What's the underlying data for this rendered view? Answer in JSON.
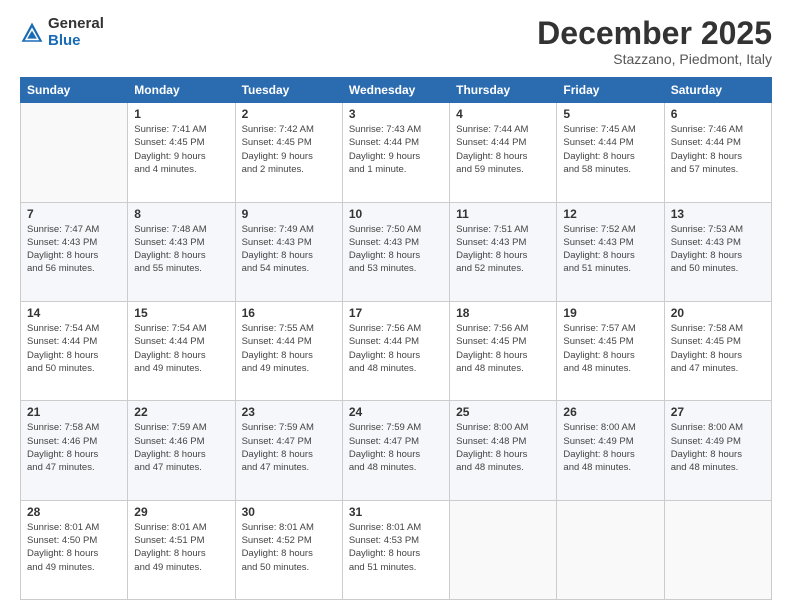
{
  "logo": {
    "general": "General",
    "blue": "Blue"
  },
  "header": {
    "month": "December 2025",
    "location": "Stazzano, Piedmont, Italy"
  },
  "days_of_week": [
    "Sunday",
    "Monday",
    "Tuesday",
    "Wednesday",
    "Thursday",
    "Friday",
    "Saturday"
  ],
  "weeks": [
    [
      {
        "day": "",
        "info": ""
      },
      {
        "day": "1",
        "info": "Sunrise: 7:41 AM\nSunset: 4:45 PM\nDaylight: 9 hours\nand 4 minutes."
      },
      {
        "day": "2",
        "info": "Sunrise: 7:42 AM\nSunset: 4:45 PM\nDaylight: 9 hours\nand 2 minutes."
      },
      {
        "day": "3",
        "info": "Sunrise: 7:43 AM\nSunset: 4:44 PM\nDaylight: 9 hours\nand 1 minute."
      },
      {
        "day": "4",
        "info": "Sunrise: 7:44 AM\nSunset: 4:44 PM\nDaylight: 8 hours\nand 59 minutes."
      },
      {
        "day": "5",
        "info": "Sunrise: 7:45 AM\nSunset: 4:44 PM\nDaylight: 8 hours\nand 58 minutes."
      },
      {
        "day": "6",
        "info": "Sunrise: 7:46 AM\nSunset: 4:44 PM\nDaylight: 8 hours\nand 57 minutes."
      }
    ],
    [
      {
        "day": "7",
        "info": "Sunrise: 7:47 AM\nSunset: 4:43 PM\nDaylight: 8 hours\nand 56 minutes."
      },
      {
        "day": "8",
        "info": "Sunrise: 7:48 AM\nSunset: 4:43 PM\nDaylight: 8 hours\nand 55 minutes."
      },
      {
        "day": "9",
        "info": "Sunrise: 7:49 AM\nSunset: 4:43 PM\nDaylight: 8 hours\nand 54 minutes."
      },
      {
        "day": "10",
        "info": "Sunrise: 7:50 AM\nSunset: 4:43 PM\nDaylight: 8 hours\nand 53 minutes."
      },
      {
        "day": "11",
        "info": "Sunrise: 7:51 AM\nSunset: 4:43 PM\nDaylight: 8 hours\nand 52 minutes."
      },
      {
        "day": "12",
        "info": "Sunrise: 7:52 AM\nSunset: 4:43 PM\nDaylight: 8 hours\nand 51 minutes."
      },
      {
        "day": "13",
        "info": "Sunrise: 7:53 AM\nSunset: 4:43 PM\nDaylight: 8 hours\nand 50 minutes."
      }
    ],
    [
      {
        "day": "14",
        "info": "Sunrise: 7:54 AM\nSunset: 4:44 PM\nDaylight: 8 hours\nand 50 minutes."
      },
      {
        "day": "15",
        "info": "Sunrise: 7:54 AM\nSunset: 4:44 PM\nDaylight: 8 hours\nand 49 minutes."
      },
      {
        "day": "16",
        "info": "Sunrise: 7:55 AM\nSunset: 4:44 PM\nDaylight: 8 hours\nand 49 minutes."
      },
      {
        "day": "17",
        "info": "Sunrise: 7:56 AM\nSunset: 4:44 PM\nDaylight: 8 hours\nand 48 minutes."
      },
      {
        "day": "18",
        "info": "Sunrise: 7:56 AM\nSunset: 4:45 PM\nDaylight: 8 hours\nand 48 minutes."
      },
      {
        "day": "19",
        "info": "Sunrise: 7:57 AM\nSunset: 4:45 PM\nDaylight: 8 hours\nand 48 minutes."
      },
      {
        "day": "20",
        "info": "Sunrise: 7:58 AM\nSunset: 4:45 PM\nDaylight: 8 hours\nand 47 minutes."
      }
    ],
    [
      {
        "day": "21",
        "info": "Sunrise: 7:58 AM\nSunset: 4:46 PM\nDaylight: 8 hours\nand 47 minutes."
      },
      {
        "day": "22",
        "info": "Sunrise: 7:59 AM\nSunset: 4:46 PM\nDaylight: 8 hours\nand 47 minutes."
      },
      {
        "day": "23",
        "info": "Sunrise: 7:59 AM\nSunset: 4:47 PM\nDaylight: 8 hours\nand 47 minutes."
      },
      {
        "day": "24",
        "info": "Sunrise: 7:59 AM\nSunset: 4:47 PM\nDaylight: 8 hours\nand 48 minutes."
      },
      {
        "day": "25",
        "info": "Sunrise: 8:00 AM\nSunset: 4:48 PM\nDaylight: 8 hours\nand 48 minutes."
      },
      {
        "day": "26",
        "info": "Sunrise: 8:00 AM\nSunset: 4:49 PM\nDaylight: 8 hours\nand 48 minutes."
      },
      {
        "day": "27",
        "info": "Sunrise: 8:00 AM\nSunset: 4:49 PM\nDaylight: 8 hours\nand 48 minutes."
      }
    ],
    [
      {
        "day": "28",
        "info": "Sunrise: 8:01 AM\nSunset: 4:50 PM\nDaylight: 8 hours\nand 49 minutes."
      },
      {
        "day": "29",
        "info": "Sunrise: 8:01 AM\nSunset: 4:51 PM\nDaylight: 8 hours\nand 49 minutes."
      },
      {
        "day": "30",
        "info": "Sunrise: 8:01 AM\nSunset: 4:52 PM\nDaylight: 8 hours\nand 50 minutes."
      },
      {
        "day": "31",
        "info": "Sunrise: 8:01 AM\nSunset: 4:53 PM\nDaylight: 8 hours\nand 51 minutes."
      },
      {
        "day": "",
        "info": ""
      },
      {
        "day": "",
        "info": ""
      },
      {
        "day": "",
        "info": ""
      }
    ]
  ]
}
